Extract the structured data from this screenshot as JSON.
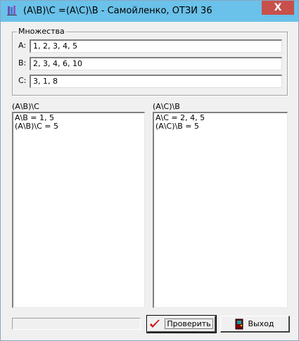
{
  "window": {
    "title": "(A\\B)\\C =(A\\C)\\B - Самойленко, ОТЗИ 36",
    "close_label": "X"
  },
  "sets": {
    "legend": "Множества",
    "a_label": "A:",
    "a_value": "1, 2, 3, 4, 5",
    "b_label": "B:",
    "b_value": "2, 3, 4, 6, 10",
    "c_label": "C:",
    "c_value": "3, 1, 8"
  },
  "left_panel": {
    "label": "(A\\B)\\C",
    "lines": [
      "A\\B = 1, 5",
      "(A\\B)\\C = 5"
    ]
  },
  "right_panel": {
    "label": "(A\\C)\\B",
    "lines": [
      "A\\C = 2, 4, 5",
      "(A\\C)\\B = 5"
    ]
  },
  "buttons": {
    "check_label": "Проверить",
    "exit_label": "Выход"
  },
  "colors": {
    "titlebar": "#6ac1e9",
    "close": "#c7504b",
    "check_mark": "#d00000"
  }
}
